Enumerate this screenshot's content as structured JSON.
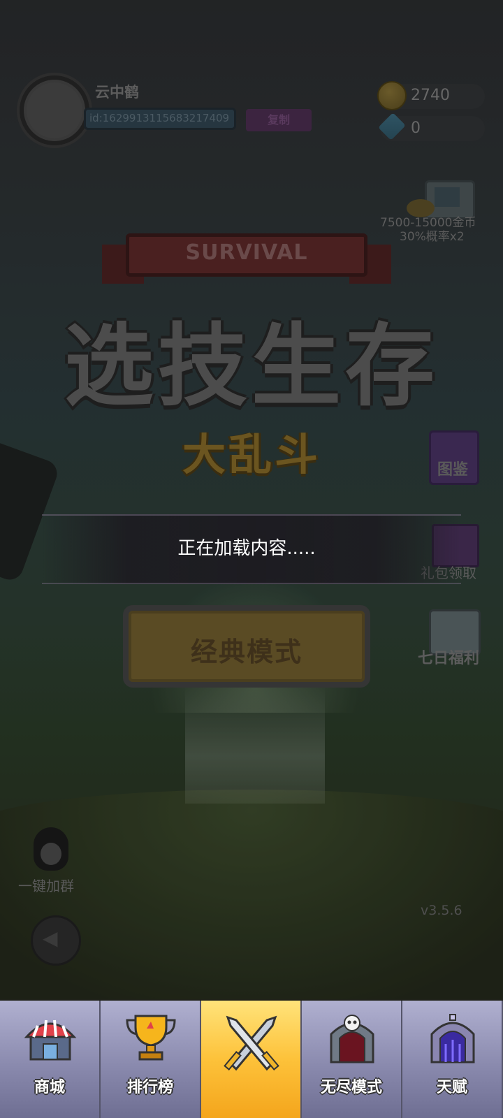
{
  "player": {
    "name": "云中鹤",
    "id": "id:1629913115683217409",
    "copy_label": "复制"
  },
  "currency": {
    "gold": "2740",
    "gems": "0"
  },
  "promo": {
    "line1": "7500-15000金币",
    "line2": "30%概率x2"
  },
  "title": {
    "banner": "SURVIVAL",
    "main": "选技生存",
    "sub": "大乱斗"
  },
  "side_menu": {
    "catalog": "图鉴",
    "gift": "礼包领取",
    "seven_day": "七日福利"
  },
  "loading": {
    "text": "正在加载内容....."
  },
  "mode_button": {
    "label": "经典模式"
  },
  "group": {
    "label": "一键加群"
  },
  "version": "v3.5.6",
  "nav": {
    "items": [
      {
        "label": "商城",
        "icon": "shop-icon"
      },
      {
        "label": "排行榜",
        "icon": "trophy-icon"
      },
      {
        "label": "",
        "icon": "crossed-swords-icon"
      },
      {
        "label": "无尽模式",
        "icon": "skull-gate-icon"
      },
      {
        "label": "天赋",
        "icon": "portal-gate-icon"
      }
    ],
    "active_index": 2
  }
}
